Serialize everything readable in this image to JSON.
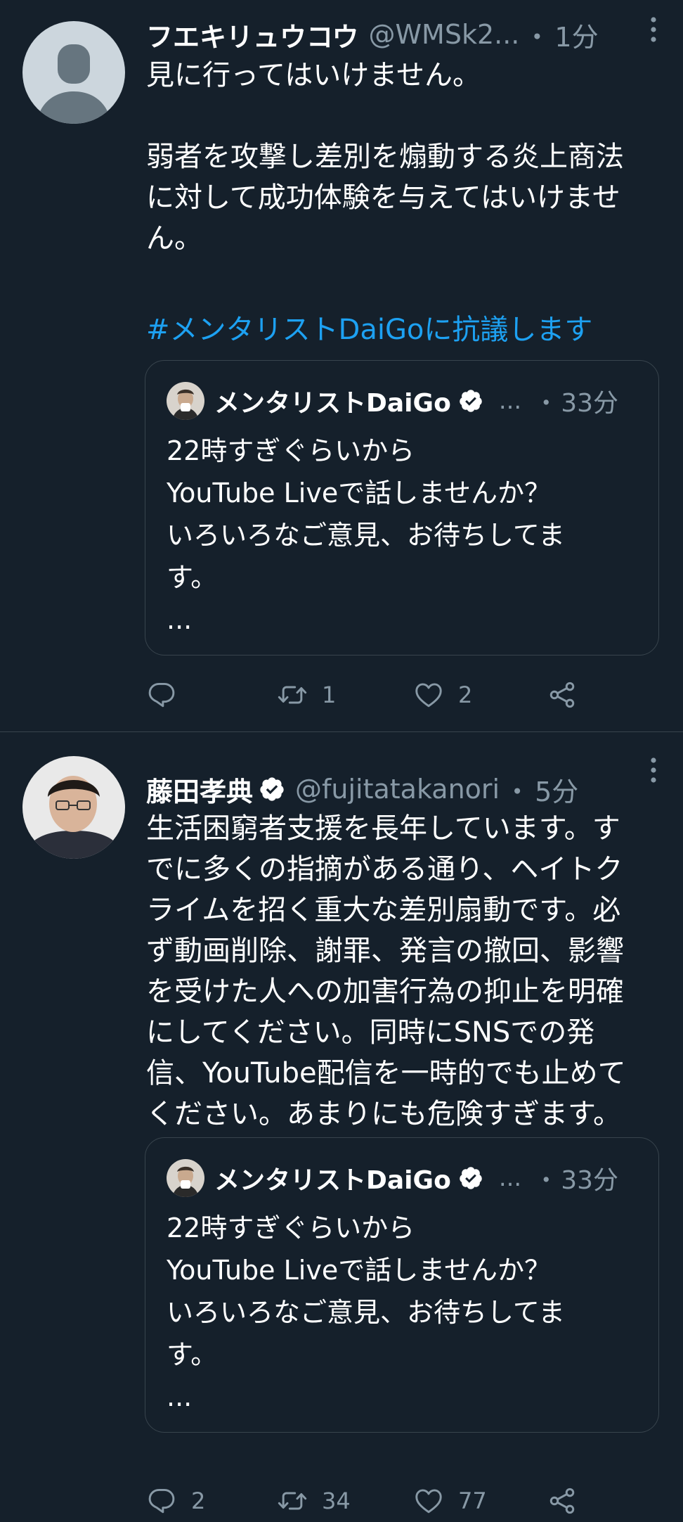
{
  "colors": {
    "background": "#15202b",
    "text": "#ffffff",
    "muted": "#8899a6",
    "link": "#1da1f2",
    "border": "#38444d"
  },
  "tweets": [
    {
      "name": "フエキリュウコウ",
      "handle": "@WMSk2...",
      "dot": "・",
      "time": "1分",
      "verified": false,
      "text": "見に行ってはいけません。\n\n弱者を攻撃し差別を煽動する炎上商法\nに対して成功体験を与えてはいけませ\nん。",
      "hashtag": "#メンタリストDaiGoに抗議します",
      "quote": {
        "name": "メンタリストDaiGo",
        "ellipsis": "...",
        "dot": "・",
        "time": "33分",
        "text": "22時すぎぐらいから\nYouTube Liveで話しませんか？\nいろいろなご意見、お待ちしてま\nす。\n..."
      },
      "reply_count": "",
      "retweet_count": "1",
      "like_count": "2"
    },
    {
      "name": "藤田孝典",
      "handle": "@fujitatakanori",
      "dot": "・",
      "time": "5分",
      "verified": true,
      "text": "生活困窮者支援を長年しています。す\nでに多くの指摘がある通り、ヘイトク\nライムを招く重大な差別扇動です。必\nず動画削除、謝罪、発言の撤回、影響\nを受けた人への加害行為の抑止を明確\nにしてください。同時にSNSでの発\n信、YouTube配信を一時的でも止めて\nください。あまりにも危険すぎます。",
      "quote": {
        "name": "メンタリストDaiGo",
        "ellipsis": "...",
        "dot": "・",
        "time": "33分",
        "text": "22時すぎぐらいから\nYouTube Liveで話しませんか？\nいろいろなご意見、お待ちしてま\nす。\n..."
      },
      "reply_count": "2",
      "retweet_count": "34",
      "like_count": "77"
    }
  ],
  "icons": {
    "reply": "reply-icon",
    "retweet": "retweet-icon",
    "like": "heart-icon",
    "share": "share-icon",
    "more": "more-vertical-icon",
    "verified": "verified-badge-icon"
  }
}
